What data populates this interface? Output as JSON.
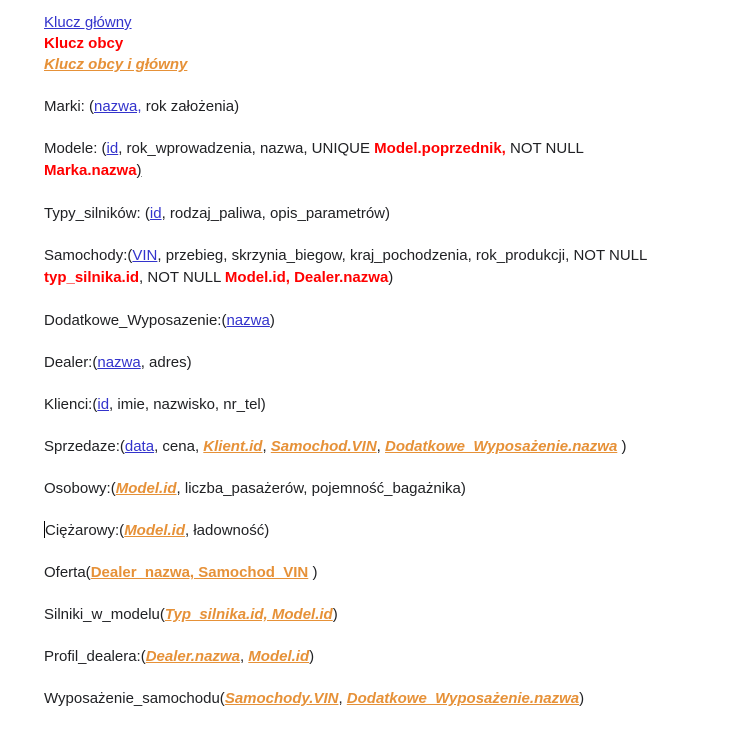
{
  "legend": {
    "primary": "Klucz główny",
    "foreign": "Klucz obcy",
    "both": "Klucz obcy i główny"
  },
  "tables": {
    "marki": {
      "name": "Marki: (",
      "pk": "nazwa,",
      "rest": " rok założenia)"
    },
    "modele": {
      "name": "Modele: (",
      "pk": "id",
      "rest1": ", rok_wprowadzenia, nazwa, UNIQUE ",
      "fk1": "Model.poprzednik,",
      "rest2": " NOT NULL",
      "fk2": "Marka.nazwa",
      "close": ")"
    },
    "typy": {
      "name": "Typy_silników: (",
      "pk": "id",
      "rest": ", rodzaj_paliwa, opis_parametrów)"
    },
    "samochody": {
      "name": "Samochody:(",
      "pk": "VIN",
      "rest1": ", przebieg, skrzynia_biegow, kraj_pochodzenia, rok_produkcji, NOT NULL",
      "fk1": "typ_silnika.id",
      "rest2": ", NOT NULL ",
      "fk2": "Model.id, Dealer.nazwa",
      "close": ")"
    },
    "dodatkowe": {
      "name": "Dodatkowe_Wyposazenie:(",
      "pk": "nazwa",
      "close": ")"
    },
    "dealer": {
      "name": "Dealer:(",
      "pk": "nazwa",
      "rest": ", adres)"
    },
    "klienci": {
      "name": "Klienci:(",
      "pk": "id",
      "rest": ", imie, nazwisko, nr_tel)"
    },
    "sprzedaze": {
      "name": "Sprzedaze:(",
      "pk": "data",
      "rest1": ", cena, ",
      "k1": "Klient.id",
      "sep1": ", ",
      "k2": "Samochod.VIN",
      "sep2": ", ",
      "k3": "Dodatkowe_Wyposażenie.nazwa",
      "close": " )"
    },
    "osobowy": {
      "name": "Osobowy:(",
      "k": "Model.id",
      "rest": ", liczba_pasażerów, pojemność_bagażnika)"
    },
    "ciezarowy": {
      "name": "Ciężarowy:(",
      "k": "Model.id",
      "rest": ", ładowność)"
    },
    "oferta": {
      "name": "Oferta(",
      "k": "Dealer_nazwa, Samochod_VIN",
      "close": " )"
    },
    "silniki": {
      "name": "Silniki_w_modelu(",
      "k": "Typ_silnika.id, Model.id",
      "close": ")"
    },
    "profil": {
      "name": "Profil_dealera:(",
      "k1": "Dealer.nazwa",
      "sep": ", ",
      "k2": "Model.id",
      "close": ")"
    },
    "wyposazenie": {
      "name": "Wyposażenie_samochodu(",
      "k1": "Samochody.VIN",
      "sep": ", ",
      "k2": "Dodatkowe_Wyposażenie.nazwa",
      "close": ")"
    }
  }
}
